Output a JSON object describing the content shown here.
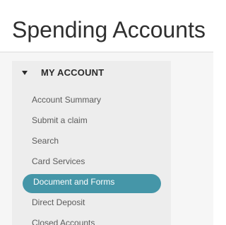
{
  "page_title": "Spending Accounts",
  "sidebar": {
    "header": "MY ACCOUNT",
    "items": [
      {
        "label": "Account Summary"
      },
      {
        "label": "Submit a claim"
      },
      {
        "label": "Search"
      },
      {
        "label": "Card Services"
      },
      {
        "label": "Document and Forms"
      },
      {
        "label": "Direct Deposit"
      },
      {
        "label": "Closed Accounts"
      }
    ],
    "active_item": "Document and Forms"
  },
  "colors": {
    "active_pill": "#4596a8",
    "sidebar_bg": "#ededed",
    "text": "#5c5c5c"
  }
}
